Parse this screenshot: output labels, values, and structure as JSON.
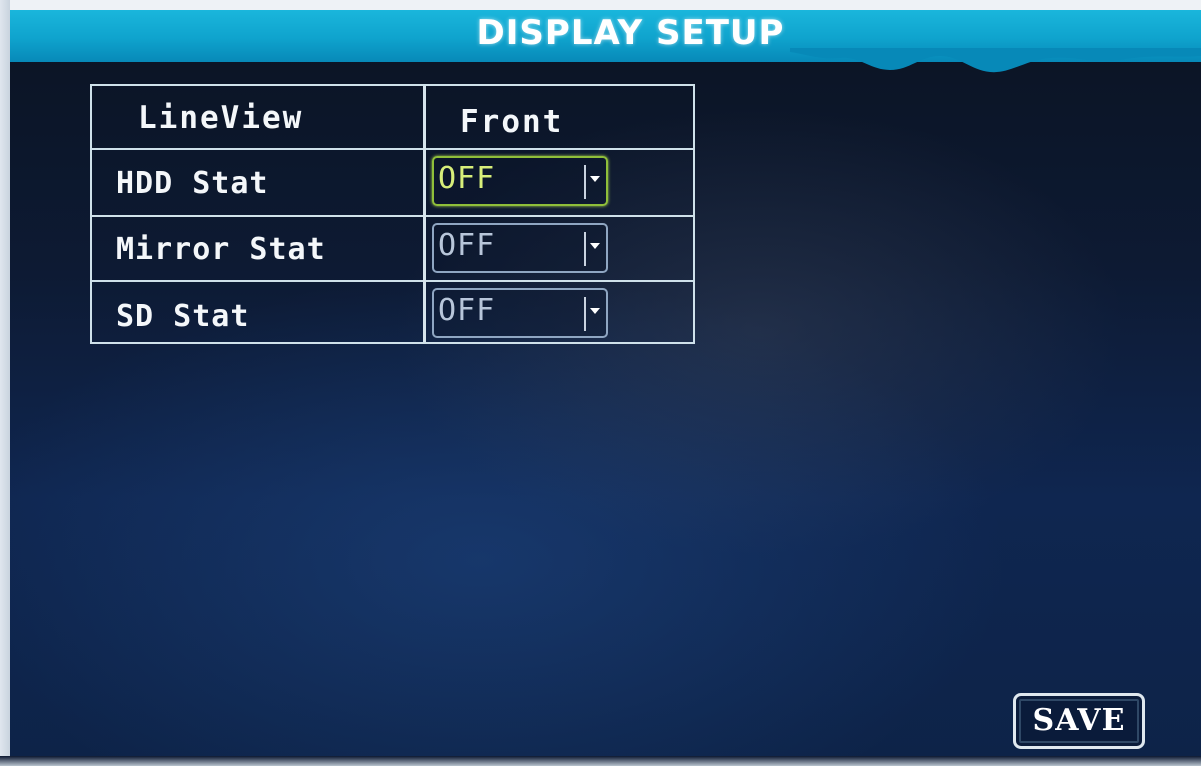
{
  "header": {
    "title": "DISPLAY SETUP"
  },
  "table": {
    "header_label": "LineView",
    "header_value": "Front",
    "rows": [
      {
        "label": "HDD Stat",
        "value": "OFF"
      },
      {
        "label": "Mirror Stat",
        "value": "OFF"
      },
      {
        "label": "SD Stat",
        "value": "OFF"
      }
    ]
  },
  "footer": {
    "save_label": "SAVE"
  },
  "colors": {
    "title_bar": "#0fa3cd",
    "background": "#0d1a33",
    "focused_field": "#8fbf3a",
    "grid_lines": "#cfe1ea"
  },
  "icons": {
    "dropdown": "chevron-down-icon"
  }
}
